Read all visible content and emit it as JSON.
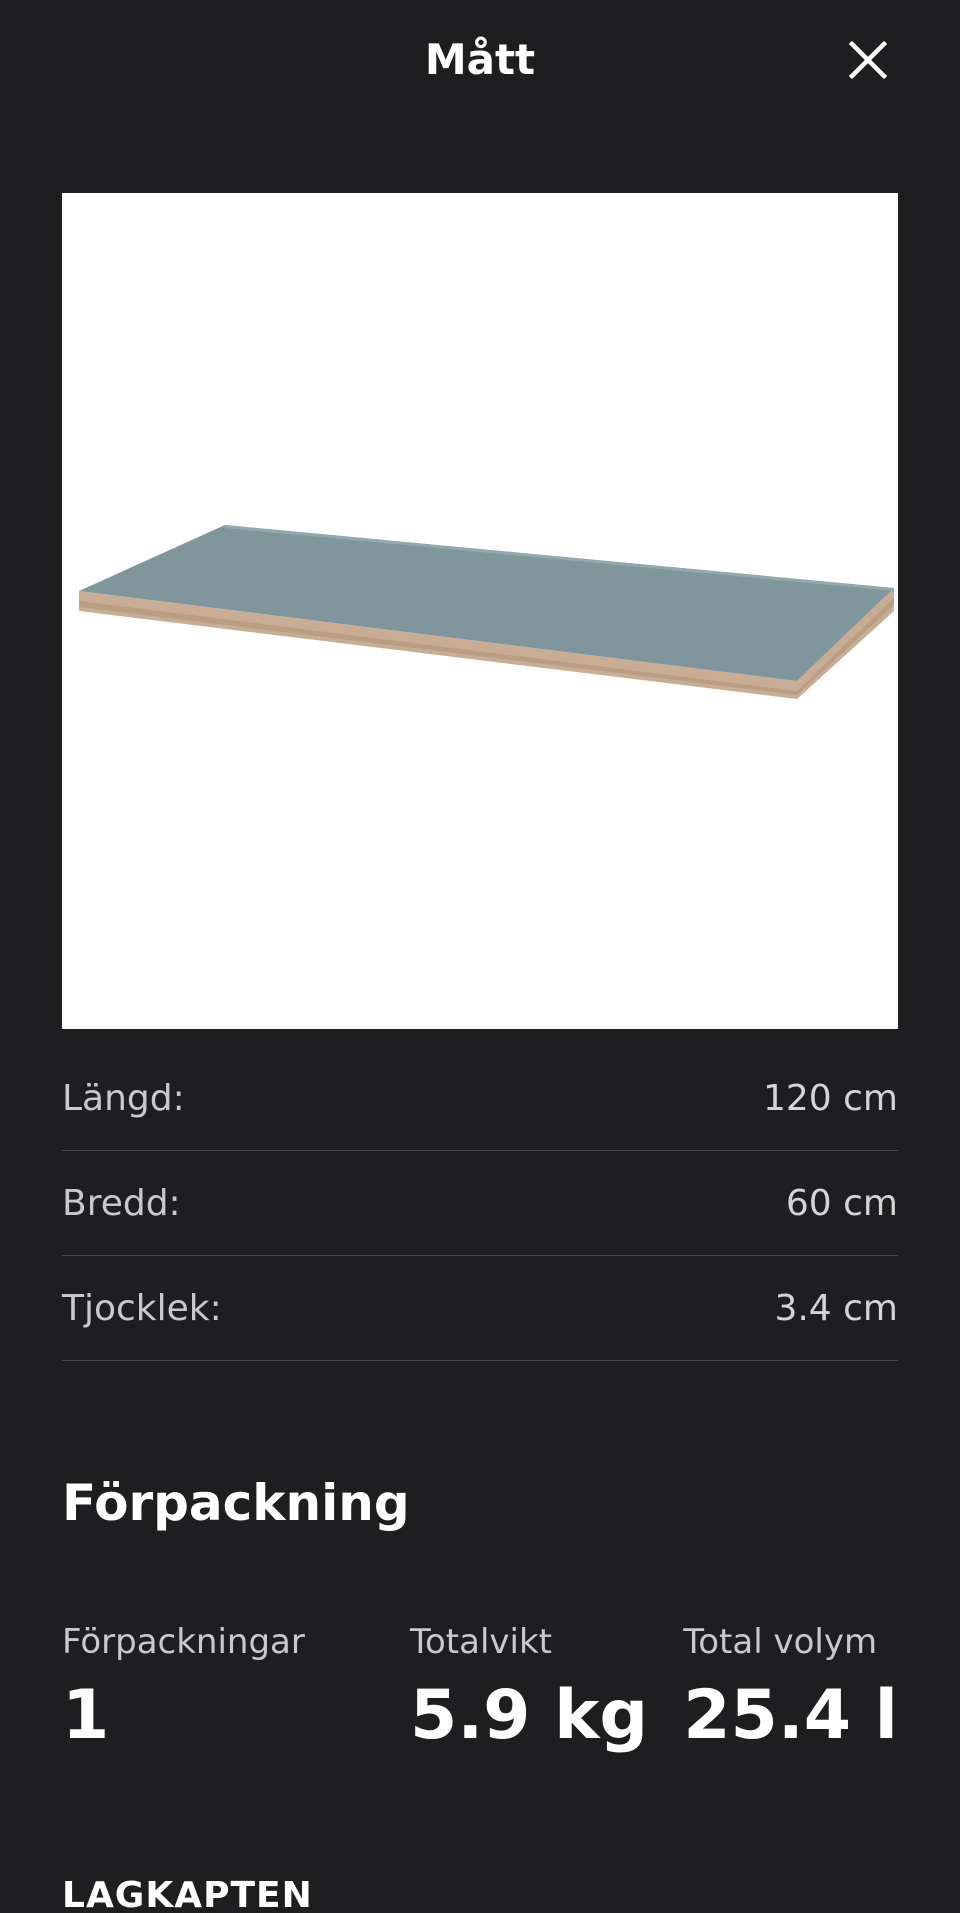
{
  "header": {
    "title": "Mått",
    "close_icon": "close-icon"
  },
  "product_image": {
    "description_icon": "table-top-image",
    "top_color": "#7f979c",
    "edge_color": "#c8ad94"
  },
  "dimensions": [
    {
      "label": "Längd:",
      "value": "120 cm"
    },
    {
      "label": "Bredd:",
      "value": "60 cm"
    },
    {
      "label": "Tjocklek:",
      "value": "3.4 cm"
    }
  ],
  "packaging": {
    "title": "Förpackning",
    "items": [
      {
        "label": "Förpackningar",
        "value": "1"
      },
      {
        "label": "Totalvikt",
        "value": "5.9 kg"
      },
      {
        "label": "Total volym",
        "value": "25.4 l"
      }
    ],
    "product_name": "LAGKAPTEN"
  }
}
